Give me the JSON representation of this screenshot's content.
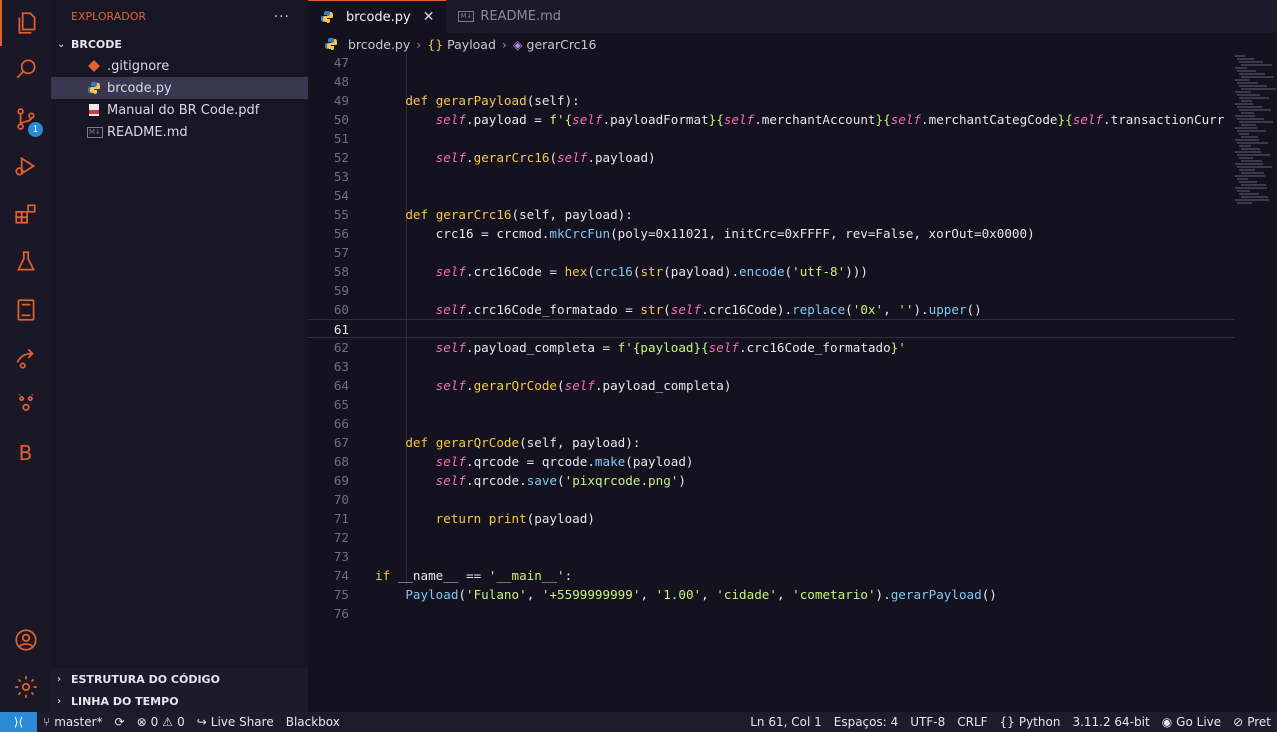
{
  "sidebar": {
    "title": "EXPLORADOR",
    "more": "···",
    "folder": "BRCODE",
    "files": [
      {
        "name": ".gitignore",
        "icon": "git-icon"
      },
      {
        "name": "brcode.py",
        "icon": "python-icon"
      },
      {
        "name": "Manual do BR Code.pdf",
        "icon": "pdf-icon"
      },
      {
        "name": "README.md",
        "icon": "markdown-icon"
      }
    ],
    "outline": "ESTRUTURA DO CÓDIGO",
    "timeline": "LINHA DO TEMPO"
  },
  "activity": {
    "scm_badge": "1",
    "letter": "B"
  },
  "tabs": [
    {
      "label": "brcode.py",
      "close": "✕"
    },
    {
      "label": "README.md",
      "tag": "M↓"
    }
  ],
  "breadcrumb": {
    "file": "brcode.py",
    "class": "Payload",
    "method": "gerarCrc16"
  },
  "code": {
    "lines": [
      {
        "n": "47",
        "tokens": []
      },
      {
        "n": "48",
        "tokens": []
      },
      {
        "n": "49",
        "tokens": [
          [
            "    ",
            "p"
          ],
          [
            "def ",
            "k"
          ],
          [
            "gerarPayload",
            "f"
          ],
          [
            "(self):",
            "p"
          ]
        ]
      },
      {
        "n": "50",
        "tokens": [
          [
            "        ",
            "p"
          ],
          [
            "self",
            "sf"
          ],
          [
            ".payload = ",
            "p"
          ],
          [
            "f'{",
            "s"
          ],
          [
            "self",
            "sf"
          ],
          [
            ".payloadFormat",
            "p"
          ],
          [
            "}{",
            "s"
          ],
          [
            "self",
            "sf"
          ],
          [
            ".merchantAccount",
            "p"
          ],
          [
            "}{",
            "s"
          ],
          [
            "self",
            "sf"
          ],
          [
            ".merchantCategCode",
            "p"
          ],
          [
            "}{",
            "s"
          ],
          [
            "self",
            "sf"
          ],
          [
            ".transactionCurr",
            "p"
          ]
        ]
      },
      {
        "n": "51",
        "tokens": []
      },
      {
        "n": "52",
        "tokens": [
          [
            "        ",
            "p"
          ],
          [
            "self",
            "sf"
          ],
          [
            ".",
            "p"
          ],
          [
            "gerarCrc16",
            "f"
          ],
          [
            "(",
            "p"
          ],
          [
            "self",
            "sf"
          ],
          [
            ".payload)",
            "p"
          ]
        ]
      },
      {
        "n": "53",
        "tokens": []
      },
      {
        "n": "54",
        "tokens": []
      },
      {
        "n": "55",
        "tokens": [
          [
            "    ",
            "p"
          ],
          [
            "def ",
            "k"
          ],
          [
            "gerarCrc16",
            "f"
          ],
          [
            "(self, payload):",
            "p"
          ]
        ]
      },
      {
        "n": "56",
        "tokens": [
          [
            "        crc16 = crcmod.",
            "p"
          ],
          [
            "mkCrcFun",
            "m"
          ],
          [
            "(poly=0x11021, initCrc=0xFFFF, rev=False, xorOut=0x0000)",
            "p"
          ]
        ]
      },
      {
        "n": "57",
        "tokens": []
      },
      {
        "n": "58",
        "tokens": [
          [
            "        ",
            "p"
          ],
          [
            "self",
            "sf"
          ],
          [
            ".crc16Code = ",
            "p"
          ],
          [
            "hex",
            "f"
          ],
          [
            "(",
            "p"
          ],
          [
            "crc16",
            "m"
          ],
          [
            "(",
            "p"
          ],
          [
            "str",
            "f"
          ],
          [
            "(payload).",
            "p"
          ],
          [
            "encode",
            "m"
          ],
          [
            "(",
            "p"
          ],
          [
            "'utf-8'",
            "s"
          ],
          [
            ")))",
            "p"
          ]
        ]
      },
      {
        "n": "59",
        "tokens": []
      },
      {
        "n": "60",
        "tokens": [
          [
            "        ",
            "p"
          ],
          [
            "self",
            "sf"
          ],
          [
            ".crc16Code_formatado = ",
            "p"
          ],
          [
            "str",
            "f"
          ],
          [
            "(",
            "p"
          ],
          [
            "self",
            "sf"
          ],
          [
            ".crc16Code).",
            "p"
          ],
          [
            "replace",
            "m"
          ],
          [
            "(",
            "p"
          ],
          [
            "'0x'",
            "s"
          ],
          [
            ", ",
            "p"
          ],
          [
            "''",
            "s"
          ],
          [
            ").",
            "p"
          ],
          [
            "upper",
            "m"
          ],
          [
            "()",
            "p"
          ]
        ]
      },
      {
        "n": "61",
        "tokens": [],
        "current": true
      },
      {
        "n": "62",
        "tokens": [
          [
            "        ",
            "p"
          ],
          [
            "self",
            "sf"
          ],
          [
            ".payload_completa = ",
            "p"
          ],
          [
            "f'{payload}{",
            "s"
          ],
          [
            "self",
            "sf"
          ],
          [
            ".crc16Code_formatado",
            "p"
          ],
          [
            "}'",
            "s"
          ]
        ]
      },
      {
        "n": "63",
        "tokens": []
      },
      {
        "n": "64",
        "tokens": [
          [
            "        ",
            "p"
          ],
          [
            "self",
            "sf"
          ],
          [
            ".",
            "p"
          ],
          [
            "gerarQrCode",
            "f"
          ],
          [
            "(",
            "p"
          ],
          [
            "self",
            "sf"
          ],
          [
            ".payload_completa)",
            "p"
          ]
        ]
      },
      {
        "n": "65",
        "tokens": []
      },
      {
        "n": "66",
        "tokens": []
      },
      {
        "n": "67",
        "tokens": [
          [
            "    ",
            "p"
          ],
          [
            "def ",
            "k"
          ],
          [
            "gerarQrCode",
            "f"
          ],
          [
            "(self, payload):",
            "p"
          ]
        ]
      },
      {
        "n": "68",
        "tokens": [
          [
            "        ",
            "p"
          ],
          [
            "self",
            "sf"
          ],
          [
            ".qrcode = qrcode.",
            "p"
          ],
          [
            "make",
            "m"
          ],
          [
            "(payload)",
            "p"
          ]
        ]
      },
      {
        "n": "69",
        "tokens": [
          [
            "        ",
            "p"
          ],
          [
            "self",
            "sf"
          ],
          [
            ".qrcode.",
            "p"
          ],
          [
            "save",
            "m"
          ],
          [
            "(",
            "p"
          ],
          [
            "'pixqrcode.png'",
            "s"
          ],
          [
            ")",
            "p"
          ]
        ]
      },
      {
        "n": "70",
        "tokens": []
      },
      {
        "n": "71",
        "tokens": [
          [
            "        ",
            "p"
          ],
          [
            "return ",
            "k"
          ],
          [
            "print",
            "f"
          ],
          [
            "(payload)",
            "p"
          ]
        ]
      },
      {
        "n": "72",
        "tokens": []
      },
      {
        "n": "73",
        "tokens": []
      },
      {
        "n": "74",
        "tokens": [
          [
            "if ",
            "k"
          ],
          [
            "__name__",
            "p"
          ],
          [
            " == ",
            "p"
          ],
          [
            "'__main__'",
            "s"
          ],
          [
            ":",
            "p"
          ]
        ]
      },
      {
        "n": "75",
        "tokens": [
          [
            "    ",
            "p"
          ],
          [
            "Payload",
            "m"
          ],
          [
            "(",
            "p"
          ],
          [
            "'Fulano'",
            "s"
          ],
          [
            ", ",
            "p"
          ],
          [
            "'+5599999999'",
            "s"
          ],
          [
            ", ",
            "p"
          ],
          [
            "'1.00'",
            "s"
          ],
          [
            ", ",
            "p"
          ],
          [
            "'cidade'",
            "s"
          ],
          [
            ", ",
            "p"
          ],
          [
            "'cometario'",
            "s"
          ],
          [
            ").",
            "p"
          ],
          [
            "gerarPayload",
            "m"
          ],
          [
            "()",
            "p"
          ]
        ]
      },
      {
        "n": "76",
        "tokens": []
      }
    ]
  },
  "status": {
    "branch": "master*",
    "errors": "0",
    "warnings": "0",
    "liveshare": "Live Share",
    "blackbox": "Blackbox",
    "position": "Ln 61, Col 1",
    "spaces": "Espaços: 4",
    "encoding": "UTF-8",
    "eol": "CRLF",
    "language": "Python",
    "interpreter": "3.11.2 64-bit",
    "golive": "Go Live",
    "prettier": "Pret"
  },
  "colors": {
    "accent": "#e0612f",
    "remote": "#2a8ad4"
  }
}
